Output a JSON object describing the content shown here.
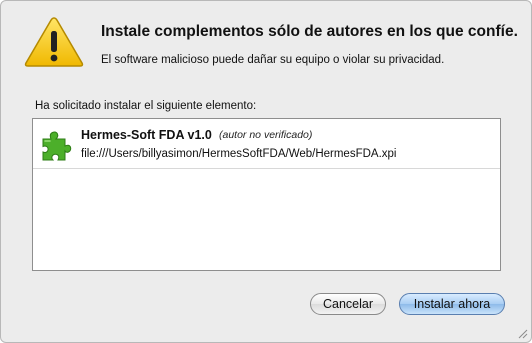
{
  "dialog": {
    "title": "Instale complementos sólo de autores en los que confíe.",
    "subtitle": "El software malicioso puede dañar su equipo o violar su privacidad.",
    "request_label": "Ha solicitado instalar el siguiente elemento:",
    "icon": "warning-icon",
    "accent_color": "#f2c200"
  },
  "item": {
    "name": "Hermes-Soft FDA v1.0",
    "note": "(autor no verificado)",
    "path": "file:///Users/billyasimon/HermesSoftFDA/Web/HermesFDA.xpi",
    "icon": "puzzle-piece-icon",
    "icon_color": "#4caf2a"
  },
  "buttons": {
    "cancel": "Cancelar",
    "install": "Instalar ahora"
  }
}
